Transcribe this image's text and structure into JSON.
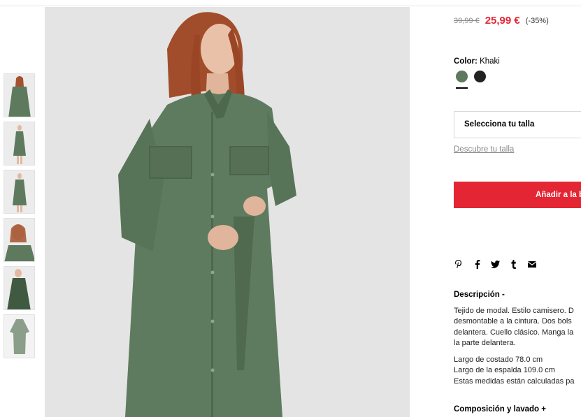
{
  "product": {
    "old_price": "39,99 €",
    "new_price": "25,99 €",
    "discount": "(-35%)",
    "color_label": "Color:",
    "color_value": "Khaki",
    "colors": [
      {
        "name": "Khaki",
        "hex": "#5e7a5e",
        "selected": true
      },
      {
        "name": "Black",
        "hex": "#222222",
        "selected": false
      }
    ],
    "size_placeholder": "Selecciona tu talla",
    "size_guide": "Descubre tu talla",
    "add_to_bag": "Añadir a la b"
  },
  "share": {
    "icons": [
      "pinterest-icon",
      "facebook-icon",
      "twitter-icon",
      "tumblr-icon",
      "email-icon"
    ]
  },
  "description": {
    "title": "Descripción -",
    "lines": [
      "Tejido de modal. Estilo camisero. D",
      "desmontable a la cintura. Dos bols",
      "delantera. Cuello clásico. Manga la",
      "la parte delantera."
    ],
    "measures": [
      "Largo de costado 78.0 cm",
      "Largo de la espalda 109.0 cm",
      "Estas medidas están calculadas pa"
    ]
  },
  "composition": {
    "title": "Composición y lavado +"
  },
  "colors": {
    "accent": "#e42634",
    "dress": "#5e7a5e",
    "text": "#000000"
  }
}
